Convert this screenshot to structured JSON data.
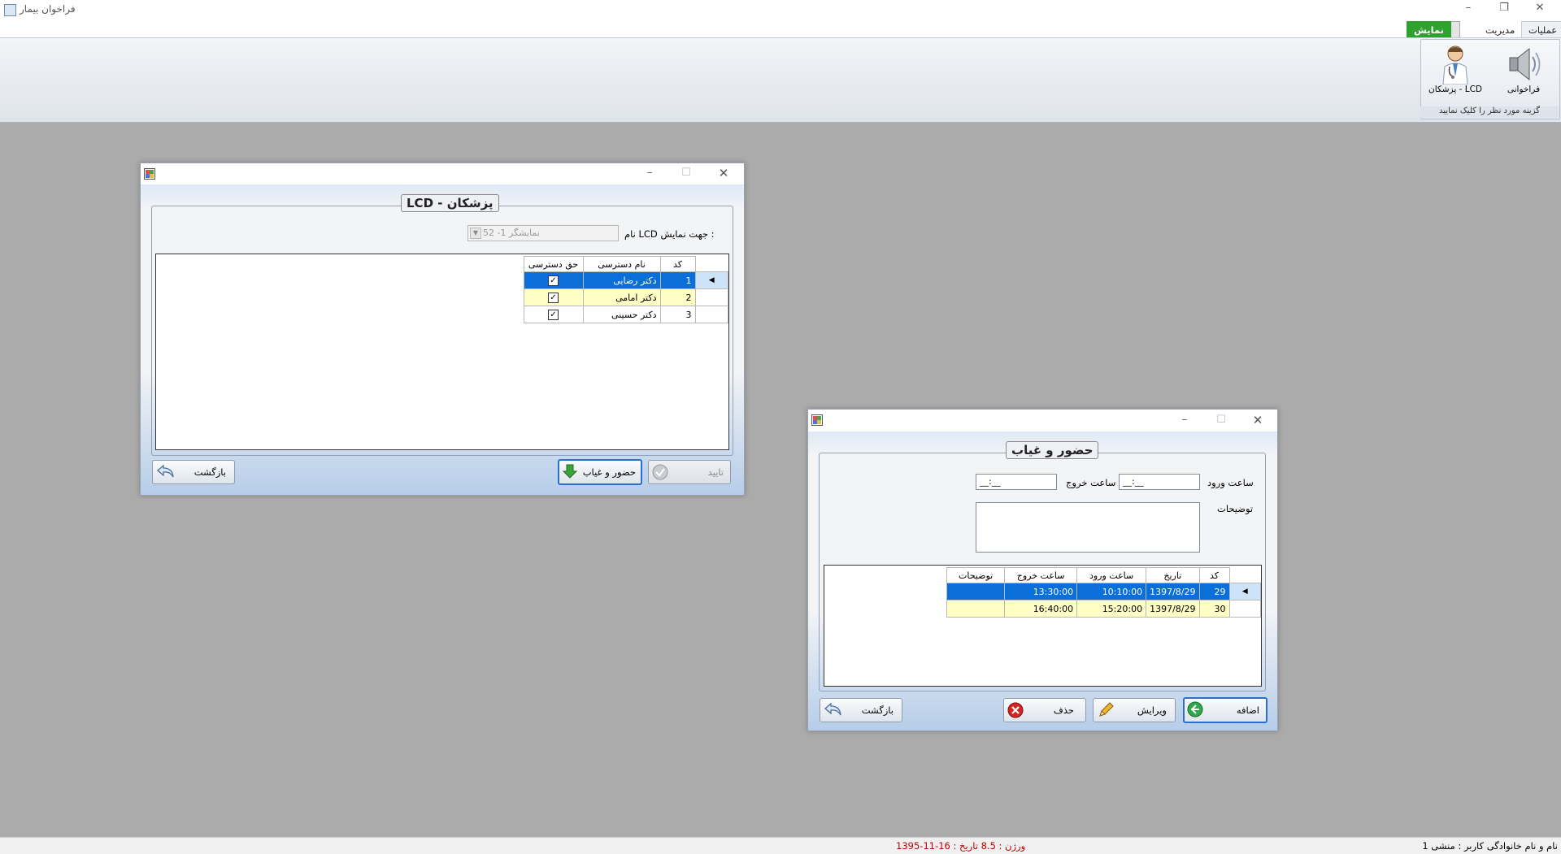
{
  "app": {
    "title": "فراخوان بیمار"
  },
  "ribbon": {
    "tabs": [
      {
        "label": "عملیات"
      },
      {
        "label": "مدیریت"
      },
      {
        "label": "نمایش"
      }
    ],
    "buttons": {
      "call": "فراخوانی",
      "doctors_lcd": "پزشکان - LCD"
    },
    "group_caption": "گزینه مورد نظر را کلیک نمایید"
  },
  "lcd_window": {
    "group_title": "LCD - پزشکان",
    "lcd_name_label": "نام LCD جهت نمایش :",
    "lcd_name_value": "نمایشگر 1- 52",
    "columns": [
      "کد",
      "نام دسترسی",
      "حق دسترسی"
    ],
    "rows": [
      {
        "code": "1",
        "name": "دکتر رضایی",
        "access": true
      },
      {
        "code": "2",
        "name": "دکتر امامی",
        "access": true
      },
      {
        "code": "3",
        "name": "دکتر حسینی",
        "access": true
      }
    ],
    "buttons": {
      "confirm": "تایید",
      "attendance": "حضور و غیاب",
      "back": "بازگشت"
    }
  },
  "attendance_window": {
    "group_title": "حضور و غیاب",
    "entry_time_label": "ساعت ورود",
    "exit_time_label": "ساعت خروج",
    "entry_time_value": "__:__",
    "exit_time_value": "__:__",
    "notes_label": "توضیحات",
    "columns": [
      "کد",
      "تاریخ",
      "ساعت ورود",
      "ساعت خروج",
      "توضیحات"
    ],
    "rows": [
      {
        "code": "29",
        "date": "1397/8/29",
        "entry": "10:10:00",
        "exit": "13:30:00",
        "notes": ""
      },
      {
        "code": "30",
        "date": "1397/8/29",
        "entry": "15:20:00",
        "exit": "16:40:00",
        "notes": ""
      }
    ],
    "buttons": {
      "add": "اضافه",
      "edit": "ویرایش",
      "delete": "حذف",
      "back": "بازگشت"
    }
  },
  "status": {
    "user": "نام و نام خانوادگی کاربر : منشی 1",
    "version": "ورژن : 8.5 تاریخ : 16-11-1395"
  },
  "colors": {
    "selection": "#0a6fd8",
    "alt_row": "#fffec4",
    "green_tab": "#2ea12e",
    "version_text": "#c00000"
  }
}
